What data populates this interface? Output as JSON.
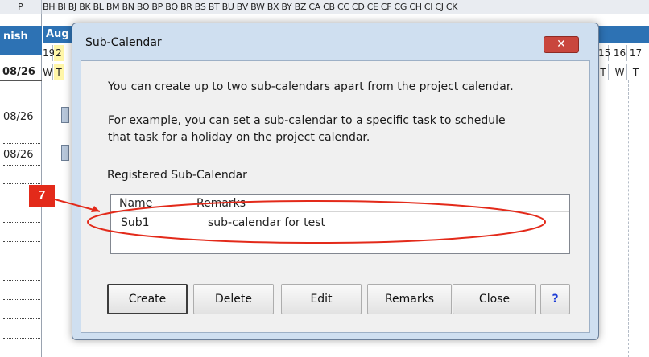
{
  "sheet": {
    "col_p": "P",
    "col_letters": "BH BI BJ BK BL BM BN BO BP BQ BR BS BT BU BV BW BX BY BZ CA CB CC CD CE CF CG CH CI CJ CK",
    "finish_label": "nish",
    "month_label": "Aug",
    "day_left": [
      "19",
      "2"
    ],
    "day_right": [
      "15",
      "16",
      "17"
    ],
    "dow_left": [
      "W",
      "T"
    ],
    "dow_right": [
      "T",
      "W",
      "T"
    ],
    "dates": [
      "08/26",
      "08/26",
      "08/26"
    ]
  },
  "dialog": {
    "title": "Sub-Calendar",
    "close_symbol": "✕",
    "info_line1": "You can create up to two sub-calendars apart from the project calendar.",
    "info_line2": "For example, you can set a sub-calendar to a specific task to schedule",
    "info_line3": "that task for a holiday on the project calendar.",
    "list_label": "Registered Sub-Calendar",
    "columns": [
      "Name",
      "Remarks"
    ],
    "rows": [
      {
        "name": "Sub1",
        "remarks": "sub-calendar for test"
      }
    ],
    "buttons": {
      "create": "Create",
      "delete": "Delete",
      "edit": "Edit",
      "remarks": "Remarks",
      "close": "Close",
      "help": "?"
    }
  },
  "annotation": {
    "badge": "7",
    "color": "#e32a1a"
  },
  "colors": {
    "header_blue": "#2d72b4",
    "dialog_frame": "#cfdff0",
    "close_red": "#c9463d"
  }
}
